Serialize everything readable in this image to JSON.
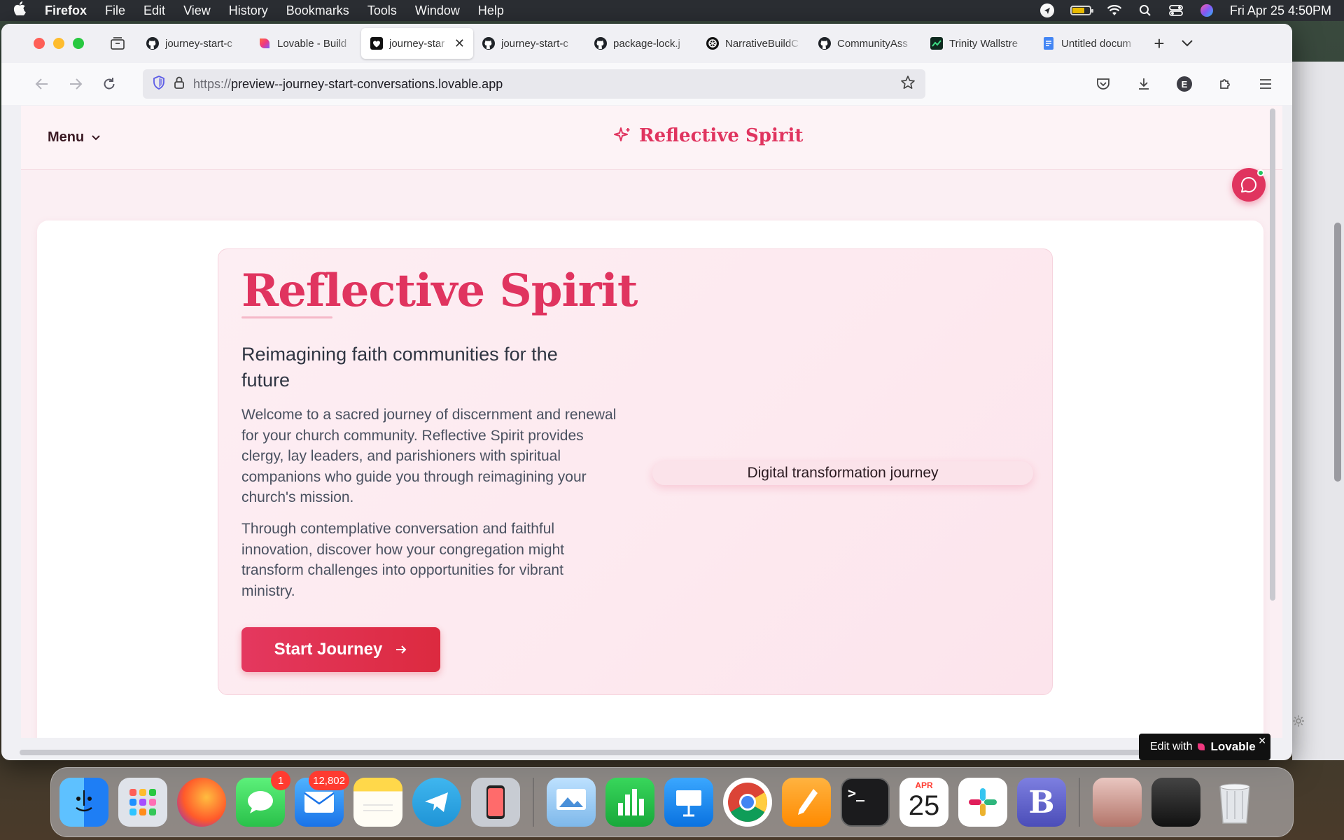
{
  "menubar": {
    "app": "Firefox",
    "items": [
      "File",
      "Edit",
      "View",
      "History",
      "Bookmarks",
      "Tools",
      "Window",
      "Help"
    ],
    "datetime": "Fri Apr 25  4:50PM"
  },
  "browser": {
    "tabs": [
      {
        "label": "journey-start-c",
        "icon": "github-icon"
      },
      {
        "label": "Lovable - Build",
        "icon": "lovable-icon"
      },
      {
        "label": "journey-star",
        "icon": "heart-icon",
        "active": true
      },
      {
        "label": "journey-start-c",
        "icon": "github-icon"
      },
      {
        "label": "package-lock.j",
        "icon": "github-icon"
      },
      {
        "label": "NarrativeBuildC",
        "icon": "openai-icon"
      },
      {
        "label": "CommunityAss",
        "icon": "github-icon"
      },
      {
        "label": "Trinity Wallstre",
        "icon": "app-icon"
      },
      {
        "label": "Untitled docum",
        "icon": "docs-icon"
      }
    ],
    "url_proto": "https://",
    "url_host": "preview--journey-start-conversations.lovable.app"
  },
  "site": {
    "menu_label": "Menu",
    "logo_text": "Reflective Spirit",
    "hero": {
      "title": "Reflective Spirit",
      "subtitle": "Reimagining faith communities for the future",
      "paragraph1": "Welcome to a sacred journey of discernment and renewal for your church community. Reflective Spirit provides clergy, lay leaders, and parishioners with spiritual companions who guide you through reimagining your church's mission.",
      "paragraph2": "Through contemplative conversation and faithful innovation, discover how your congregation might transform challenges into opportunities for vibrant ministry.",
      "cta_label": "Start Journey",
      "pill_label": "Digital transformation journey"
    },
    "badge": {
      "prefix": "Edit with",
      "brand": "Lovable"
    }
  },
  "dock": {
    "messages_badge": "1",
    "mail_badge": "12,802",
    "calendar_month": "APR",
    "calendar_day": "25"
  },
  "colors": {
    "accent": "#e0345f",
    "cta_start": "#e4385f",
    "cta_end": "#dc2a3f"
  }
}
